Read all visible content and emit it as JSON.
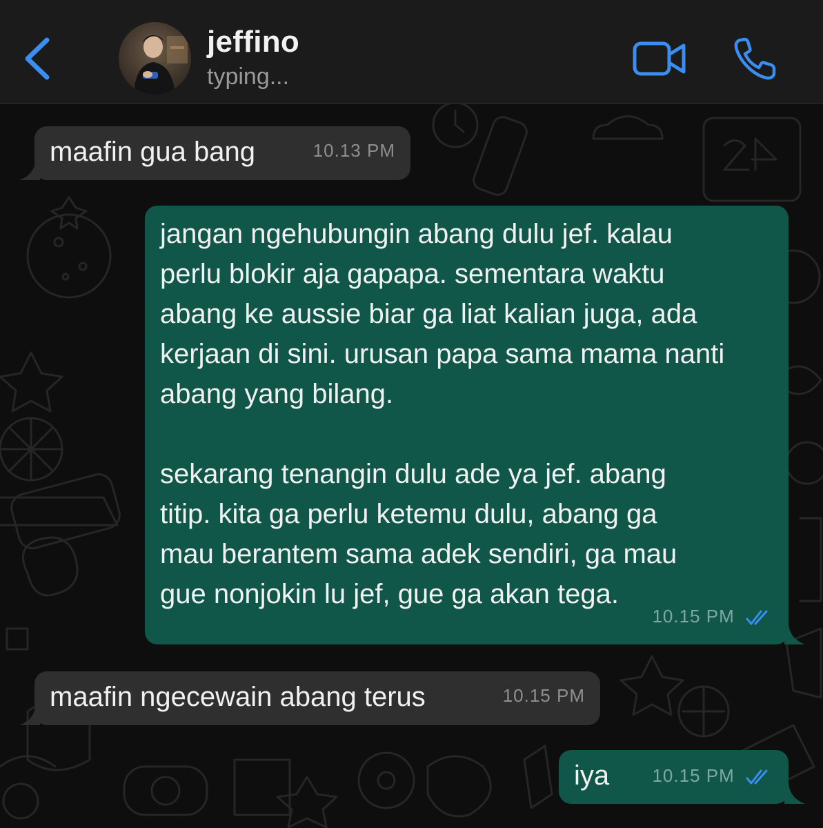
{
  "header": {
    "contact_name": "jeffino",
    "status": "typing...",
    "back_icon": "chevron-left-icon",
    "video_icon": "video-camera-icon",
    "call_icon": "phone-icon",
    "accent_color": "#3a8ef0"
  },
  "messages": [
    {
      "direction": "incoming",
      "text": "maafin gua bang",
      "time": "10.13 PM"
    },
    {
      "direction": "outgoing",
      "text": "jangan ngehubungin abang dulu jef. kalau\nperlu blokir aja gapapa. sementara waktu\nabang ke aussie biar ga liat kalian juga, ada\nkerjaan di sini. urusan papa sama mama nanti\nabang yang bilang.\n\nsekarang tenangin dulu ade ya jef. abang\ntitip. kita ga perlu ketemu dulu, abang ga\nmau berantem sama adek sendiri, ga mau\ngue nonjokin lu jef, gue ga akan tega.",
      "time": "10.15 PM",
      "status": "read"
    },
    {
      "direction": "incoming",
      "text": "maafin ngecewain abang terus",
      "time": "10.15 PM"
    },
    {
      "direction": "outgoing",
      "text": "iya",
      "time": "10.15 PM",
      "status": "read"
    }
  ],
  "colors": {
    "incoming_bubble": "#2f2f2f",
    "outgoing_bubble": "#10574a",
    "read_ticks": "#3a8ef0"
  }
}
